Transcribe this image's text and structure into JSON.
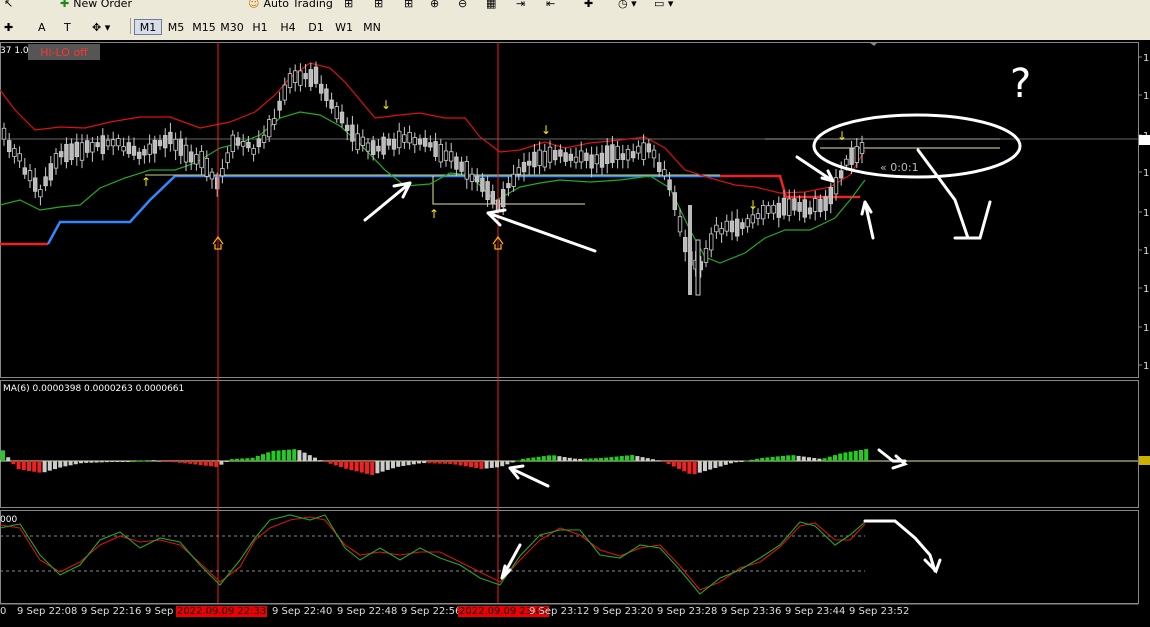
{
  "toolbar": {
    "new_order": "New Order",
    "auto_trading": "Auto Trading",
    "timeframes": [
      "M1",
      "M5",
      "M15",
      "M30",
      "H1",
      "H4",
      "D1",
      "W1",
      "MN"
    ],
    "active_timeframe": "M1"
  },
  "chart": {
    "indicator_button": "Hi-LO off",
    "top_left_label": "37 1.00",
    "ma_label": "MA(6) 0.0000398 0.0000263 0.0000661",
    "stoch_label": "000",
    "countdown": "« 0:0:1",
    "annotation_mark": "?",
    "time_labels": [
      "9 Sep 22:08",
      "9 Sep 22:16",
      "9 Sep 2",
      "2022.09.09 22:33",
      "9 Sep 22:40",
      "9 Sep 22:48",
      "9 Sep 22:56",
      "2022.09.09 23:08",
      "9 Sep 23:12",
      "9 Sep 23:20",
      "9 Sep 23:28",
      "9 Sep 23:36",
      "9 Sep 23:44",
      "9 Sep 23:52"
    ]
  },
  "colors": {
    "background": "#000000",
    "bull_bar": "#22cc22",
    "bear_bar": "#ee2222",
    "neutral_bar": "#cccccc",
    "upper_band": "#dd1111",
    "lower_band": "#22aa22",
    "support_line": "#3388ff",
    "marker_line": "#ee2222",
    "arrow_up": "#ffcc00"
  }
}
